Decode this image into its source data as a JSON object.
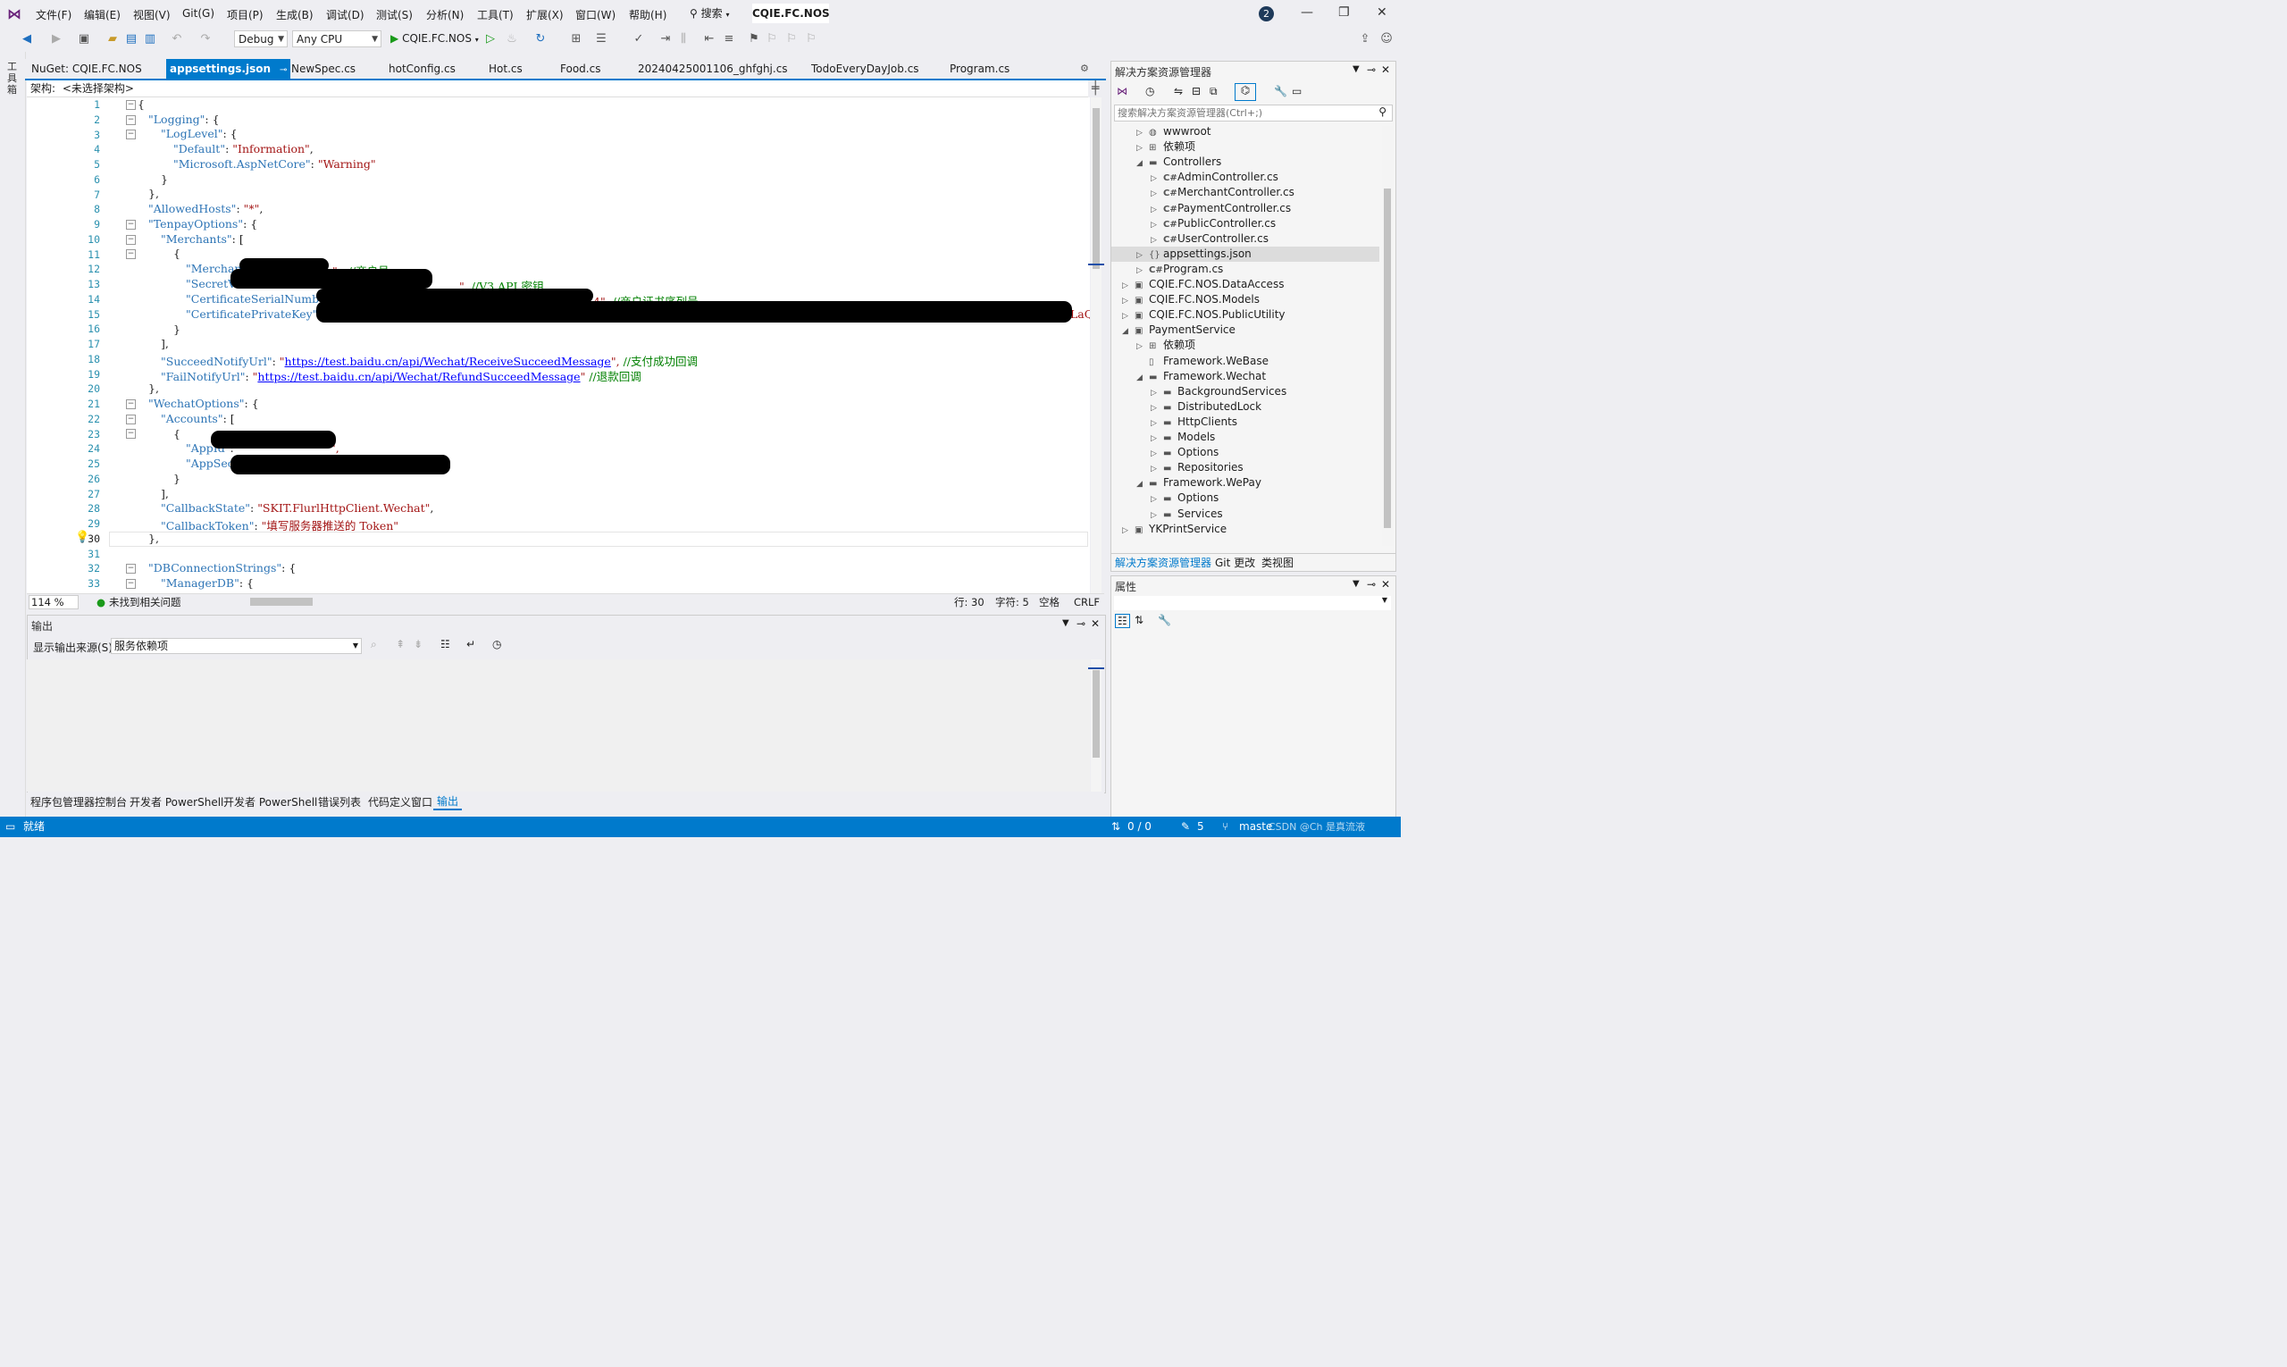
{
  "menubar": {
    "items": [
      "文件(F)",
      "编辑(E)",
      "视图(V)",
      "Git(G)",
      "项目(P)",
      "生成(B)",
      "调试(D)",
      "测试(S)",
      "分析(N)",
      "工具(T)",
      "扩展(X)",
      "窗口(W)",
      "帮助(H)"
    ],
    "search_label": "搜索",
    "solution_title": "CQIE.FC.NOS",
    "notification_count": "2"
  },
  "toolbar": {
    "config": "Debug",
    "platform": "Any CPU",
    "run_target": "CQIE.FC.NOS"
  },
  "left_strip": {
    "label": "工具箱"
  },
  "tabs": [
    "NuGet: CQIE.FC.NOS",
    "appsettings.json",
    "NewSpec.cs",
    "hotConfig.cs",
    "Hot.cs",
    "Food.cs",
    "20240425001106_ghfghj.cs",
    "TodoEveryDayJob.cs",
    "Program.cs"
  ],
  "active_tab": "appsettings.json",
  "navbar": {
    "label": "架构:",
    "value": "<未选择架构>"
  },
  "editor": {
    "line_numbers": [
      "1",
      "2",
      "3",
      "4",
      "5",
      "6",
      "7",
      "8",
      "9",
      "10",
      "11",
      "12",
      "13",
      "14",
      "15",
      "16",
      "17",
      "18",
      "19",
      "20",
      "21",
      "22",
      "23",
      "24",
      "25",
      "26",
      "27",
      "28",
      "29",
      "30",
      "31",
      "32",
      "33"
    ],
    "lines": {
      "l1": "{",
      "l2k": "\"Logging\"",
      "l2p": ": {",
      "l3k": "\"LogLevel\"",
      "l3p": ": {",
      "l4k": "\"Default\"",
      "l4p": ": ",
      "l4v": "\"Information\"",
      "l4e": ",",
      "l5k": "\"Microsoft.AspNetCore\"",
      "l5p": ": ",
      "l5v": "\"Warning\"",
      "l6": "}",
      "l7": "},",
      "l8k": "\"AllowedHosts\"",
      "l8p": ": ",
      "l8v": "\"*\"",
      "l8e": ",",
      "l9k": "\"TenpayOptions\"",
      "l9p": ": {",
      "l10k": "\"Merchants\"",
      "l10p": ": [",
      "l11": "{",
      "l12k": "\"MerchantId\"",
      "l12p": ":",
      "l12v": "\"",
      "l12e": "\",",
      "l12c": "//商户号",
      "l13k": "\"SecretV3\"",
      "l13p": ":",
      "l13e": "\",",
      "l13c": "//V3 API 密钥",
      "l14k": "\"CertificateSerialNumber\"",
      "l14p": ": ",
      "l14v": "\"",
      "l14e": "4\",",
      "l14c": "//商户证书序列号",
      "l15k": "\"CertificatePrivateKey\"",
      "l15p": ": ",
      "l15v": "\"",
      "l15e": "LaQ",
      "l16": "}",
      "l17": "],",
      "l18k": "\"SucceedNotifyUrl\"",
      "l18p": ": ",
      "l18q": "\"",
      "l18u": "https://test.baidu.cn/api/Wechat/ReceiveSucceedMessage",
      "l18e": "\",",
      "l18c": "//支付成功回调",
      "l19k": "\"FailNotifyUrl\"",
      "l19p": ": ",
      "l19q": "\"",
      "l19u": "https://test.baidu.cn/api/Wechat/RefundSucceedMessage",
      "l19e": "\"",
      "l19c": "//退款回调",
      "l20": "},",
      "l21k": "\"WechatOptions\"",
      "l21p": ": {",
      "l22k": "\"Accounts\"",
      "l22p": ": [",
      "l23": "{",
      "l24k": "\"AppId\"",
      "l24p": ":",
      "l24e": "\",",
      "l25k": "\"AppSecret\"",
      "l25p": ":",
      "l26": "}",
      "l27": "],",
      "l28k": "\"CallbackState\"",
      "l28p": ": ",
      "l28v": "\"SKIT.FlurlHttpClient.Wechat\"",
      "l28e": ",",
      "l29k": "\"CallbackToken\"",
      "l29p": ": ",
      "l29v": "\"填写服务器推送的 Token\"",
      "l30": "},",
      "l31": "",
      "l32k": "\"DBConnectionStrings\"",
      "l32p": ": {",
      "l33k": "\"ManagerDB\"",
      "l33p": ": {"
    }
  },
  "editor_status": {
    "zoom": "114 %",
    "issues": "未找到相关问题",
    "line": "行: 30",
    "char": "字符: 5",
    "whitespace": "空格",
    "eol": "CRLF"
  },
  "output": {
    "title": "输出",
    "source_label": "显示输出来源(S):",
    "source_value": "服务依赖项"
  },
  "bottom_tabs": [
    "程序包管理器控制台",
    "开发者 PowerShell",
    "开发者 PowerShell",
    "错误列表",
    "代码定义窗口",
    "输出"
  ],
  "statusbar": {
    "ready": "就绪",
    "changes": "0 / 0",
    "edits": "5",
    "branch": "maste",
    "extra": "CSDN @Ch 是真流液"
  },
  "solution_explorer": {
    "title": "解决方案资源管理器",
    "search_placeholder": "搜索解决方案资源管理器(Ctrl+;)",
    "items": [
      {
        "label": "wwwroot",
        "icon": "globe-icon"
      },
      {
        "label": "依赖项",
        "icon": "dependencies-icon"
      },
      {
        "label": "Controllers",
        "icon": "folder-icon"
      },
      {
        "label": "AdminController.cs",
        "icon": "csharp-file-icon"
      },
      {
        "label": "MerchantController.cs",
        "icon": "csharp-file-icon"
      },
      {
        "label": "PaymentController.cs",
        "icon": "csharp-file-icon"
      },
      {
        "label": "PublicController.cs",
        "icon": "csharp-file-icon"
      },
      {
        "label": "UserController.cs",
        "icon": "csharp-file-icon"
      },
      {
        "label": "appsettings.json",
        "icon": "json-file-icon"
      },
      {
        "label": "Program.cs",
        "icon": "csharp-file-icon"
      },
      {
        "label": "CQIE.FC.NOS.DataAccess",
        "icon": "project-icon"
      },
      {
        "label": "CQIE.FC.NOS.Models",
        "icon": "project-icon"
      },
      {
        "label": "CQIE.FC.NOS.PublicUtility",
        "icon": "project-icon"
      },
      {
        "label": "PaymentService",
        "icon": "project-icon"
      },
      {
        "label": "依赖项",
        "icon": "dependencies-icon"
      },
      {
        "label": "Framework.WeBase",
        "icon": "file-icon"
      },
      {
        "label": "Framework.Wechat",
        "icon": "folder-icon"
      },
      {
        "label": "BackgroundServices",
        "icon": "folder-icon"
      },
      {
        "label": "DistributedLock",
        "icon": "folder-icon"
      },
      {
        "label": "HttpClients",
        "icon": "folder-icon"
      },
      {
        "label": "Models",
        "icon": "folder-icon"
      },
      {
        "label": "Options",
        "icon": "folder-icon"
      },
      {
        "label": "Repositories",
        "icon": "folder-icon"
      },
      {
        "label": "Framework.WePay",
        "icon": "folder-icon"
      },
      {
        "label": "Options",
        "icon": "folder-icon"
      },
      {
        "label": "Services",
        "icon": "folder-icon"
      },
      {
        "label": "YKPrintService",
        "icon": "project-icon"
      }
    ],
    "bottom_tabs": [
      "解决方案资源管理器",
      "Git 更改",
      "类视图"
    ]
  },
  "properties": {
    "title": "属性"
  },
  "colors": {
    "accent": "#007acc",
    "keyword": "#2e75b6",
    "string": "#a31515",
    "comment": "#008000"
  }
}
